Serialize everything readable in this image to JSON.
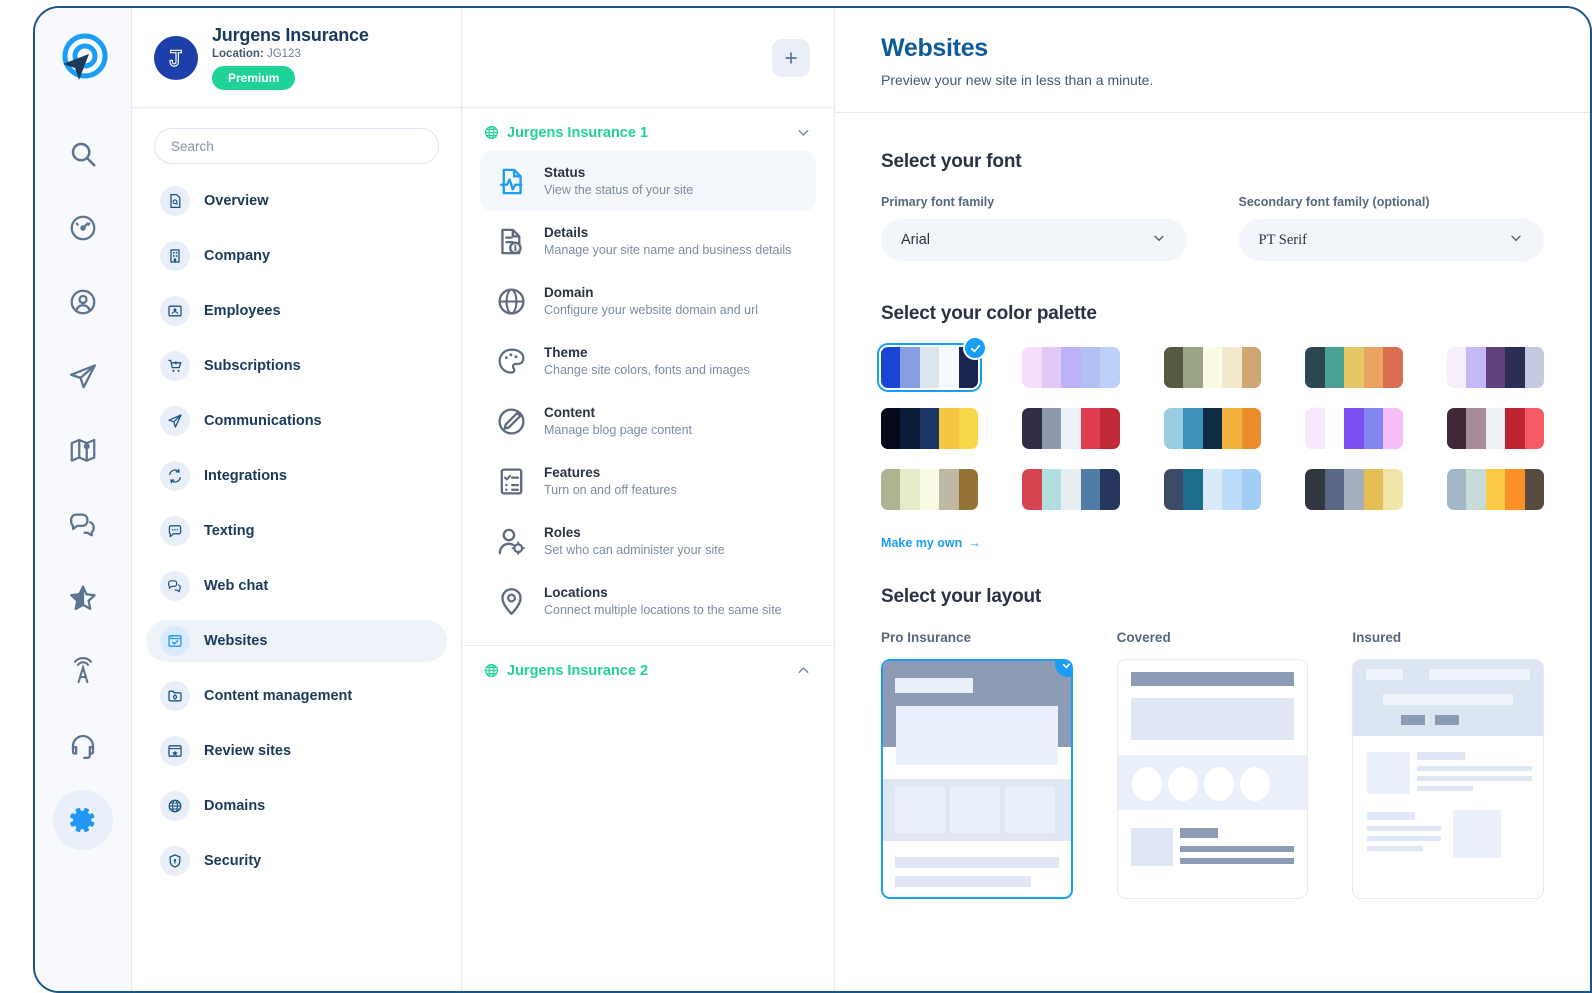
{
  "colors": {
    "brand_blue": "#1a9ef5",
    "deep_blue": "#0f5b9a",
    "green": "#1fd396",
    "frame_border": "#1a5584"
  },
  "icon_rail": {
    "logo_name": "app-logo",
    "items": [
      {
        "name": "search-icon",
        "label": "Search"
      },
      {
        "name": "dashboard-icon",
        "label": "Dashboard"
      },
      {
        "name": "contacts-icon",
        "label": "Contacts"
      },
      {
        "name": "send-icon",
        "label": "Campaigns"
      },
      {
        "name": "map-icon",
        "label": "Map"
      },
      {
        "name": "chat-icon",
        "label": "Conversations"
      },
      {
        "name": "star-icon",
        "label": "Reviews"
      },
      {
        "name": "broadcast-icon",
        "label": "Broadcast"
      },
      {
        "name": "support-icon",
        "label": "Support"
      },
      {
        "name": "settings-gear-icon",
        "label": "Settings",
        "active": true
      }
    ]
  },
  "org": {
    "name": "Jurgens Insurance",
    "location_label": "Location:",
    "location_value": "JG123",
    "plan_badge": "Premium",
    "avatar_letter": "J"
  },
  "search": {
    "placeholder": "Search",
    "value": ""
  },
  "nav": {
    "items": [
      {
        "label": "Overview",
        "icon": "document-search-icon",
        "active": false
      },
      {
        "label": "Company",
        "icon": "building-icon",
        "active": false
      },
      {
        "label": "Employees",
        "icon": "employees-icon",
        "active": false
      },
      {
        "label": "Subscriptions",
        "icon": "cart-plus-icon",
        "active": false
      },
      {
        "label": "Communications",
        "icon": "paper-plane-icon",
        "active": false
      },
      {
        "label": "Integrations",
        "icon": "sync-icon",
        "active": false
      },
      {
        "label": "Texting",
        "icon": "message-dots-icon",
        "active": false
      },
      {
        "label": "Web chat",
        "icon": "chat-bubbles-icon",
        "active": false
      },
      {
        "label": "Websites",
        "icon": "browser-check-icon",
        "active": true
      },
      {
        "label": "Content management",
        "icon": "folder-gear-icon",
        "active": false
      },
      {
        "label": "Review sites",
        "icon": "browser-star-icon",
        "active": false
      },
      {
        "label": "Domains",
        "icon": "globe-icon",
        "active": false
      },
      {
        "label": "Security",
        "icon": "shield-icon",
        "active": false
      }
    ]
  },
  "site_panel": {
    "add_button_label": "+",
    "groups": [
      {
        "title": "Jurgens Insurance 1",
        "expanded": true,
        "chevron": "down",
        "items": [
          {
            "title": "Status",
            "subtitle": "View the status of your site",
            "icon": "file-pulse-icon",
            "active": true
          },
          {
            "title": "Details",
            "subtitle": "Manage your site name and business details",
            "icon": "file-info-icon",
            "active": false
          },
          {
            "title": "Domain",
            "subtitle": "Configure your website domain and url",
            "icon": "globe-icon",
            "active": false
          },
          {
            "title": "Theme",
            "subtitle": "Change site colors, fonts and images",
            "icon": "palette-icon",
            "active": false
          },
          {
            "title": "Content",
            "subtitle": "Manage blog page content",
            "icon": "pencil-circle-icon",
            "active": false
          },
          {
            "title": "Features",
            "subtitle": "Turn on and off features",
            "icon": "checklist-icon",
            "active": false
          },
          {
            "title": "Roles",
            "subtitle": "Set who can administer your site",
            "icon": "user-gear-icon",
            "active": false
          },
          {
            "title": "Locations",
            "subtitle": "Connect multiple locations to the same site",
            "icon": "map-pin-icon",
            "active": false
          }
        ]
      },
      {
        "title": "Jurgens Insurance 2",
        "expanded": false,
        "chevron": "up",
        "items": []
      }
    ]
  },
  "content": {
    "title": "Websites",
    "subtitle": "Preview your new site in less than a minute.",
    "font_section": {
      "heading": "Select your font",
      "primary": {
        "label": "Primary font family",
        "value": "Arial"
      },
      "secondary": {
        "label": "Secondary font family (optional)",
        "value": "PT Serif"
      }
    },
    "palette_section": {
      "heading": "Select your color palette",
      "make_own_label": "Make my own",
      "make_own_arrow": "→",
      "selected_index": 0,
      "palettes": [
        {
          "name": "blue-navy",
          "colors": [
            "#1945d6",
            "#879fe0",
            "#dbe6ef",
            "#f7fafd",
            "#18254f"
          ]
        },
        {
          "name": "lilac-pastel",
          "colors": [
            "#f6ddfb",
            "#e2c8f6",
            "#bdb1f7",
            "#b3c0f3",
            "#bdd0f6"
          ]
        },
        {
          "name": "olive-sand",
          "colors": [
            "#535a40",
            "#9ba387",
            "#fbfae4",
            "#f3e9cf",
            "#cda673"
          ]
        },
        {
          "name": "teal-terracotta",
          "colors": [
            "#2d4751",
            "#4ba193",
            "#e5c767",
            "#eaa362",
            "#da6e4e"
          ]
        },
        {
          "name": "violet-ice",
          "colors": [
            "#f6eefb",
            "#c4b8f9",
            "#63417f",
            "#2c2e55",
            "#c4cbe0"
          ]
        },
        {
          "name": "midnight-gold",
          "colors": [
            "#030b1c",
            "#0b1c3b",
            "#1a3566",
            "#f4c740",
            "#f8d849"
          ]
        },
        {
          "name": "slate-crimson",
          "colors": [
            "#302f47",
            "#8e99ad",
            "#edf1f5",
            "#dd3d4d",
            "#c22936"
          ]
        },
        {
          "name": "sky-amber",
          "colors": [
            "#9bcde2",
            "#3f93b9",
            "#0e2c44",
            "#f2b13c",
            "#ec8b2c"
          ]
        },
        {
          "name": "lavender-pop",
          "colors": [
            "#f7e8fb",
            "#fdfdff",
            "#7b4ef0",
            "#8085ef",
            "#f7bdf9"
          ]
        },
        {
          "name": "plum-red",
          "colors": [
            "#3f2838",
            "#a68b99",
            "#edf1f5",
            "#be2431",
            "#f65b63"
          ]
        },
        {
          "name": "sage-wheat",
          "colors": [
            "#adb491",
            "#e5ebc9",
            "#fbfae4",
            "#c0b9a2",
            "#957337"
          ]
        },
        {
          "name": "red-steel",
          "colors": [
            "#d6454d",
            "#b2dee0",
            "#e9eef2",
            "#4f7ba5",
            "#25375c"
          ]
        },
        {
          "name": "navy-sky",
          "colors": [
            "#3d4b66",
            "#1c6e8c",
            "#dbeafb",
            "#bcdcfa",
            "#a4cdf6"
          ]
        },
        {
          "name": "charcoal-gold",
          "colors": [
            "#32363f",
            "#586788",
            "#a4aebf",
            "#e4bd55",
            "#efe5a8"
          ]
        },
        {
          "name": "steel-orange",
          "colors": [
            "#a3b6c5",
            "#c7dcd8",
            "#fccb45",
            "#fb9029",
            "#564b3e"
          ]
        }
      ]
    },
    "layout_section": {
      "heading": "Select your layout",
      "selected_index": 0,
      "layouts": [
        {
          "name": "Pro Insurance"
        },
        {
          "name": "Covered"
        },
        {
          "name": "Insured"
        }
      ]
    }
  }
}
